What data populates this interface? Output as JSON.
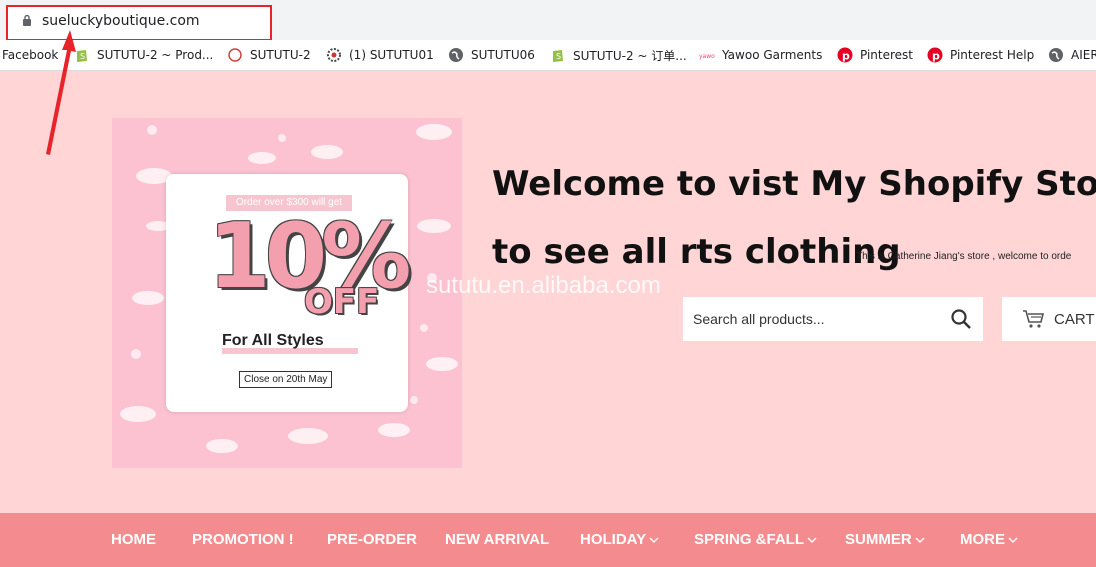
{
  "browser": {
    "url": "sueluckyboutique.com",
    "bookmarks": [
      {
        "label": "Facebook",
        "icon": "none"
      },
      {
        "label": "SUTUTU-2 ~ Prod...",
        "icon": "shopify-icon"
      },
      {
        "label": "SUTUTU-2",
        "icon": "sututu-icon"
      },
      {
        "label": "(1) SUTUTU01",
        "icon": "gear-badge-icon"
      },
      {
        "label": "SUTUTU06",
        "icon": "globe-icon"
      },
      {
        "label": "SUTUTU-2 ~ 订单...",
        "icon": "shopify-icon"
      },
      {
        "label": "Yawoo Garments",
        "icon": "yawoo-icon"
      },
      {
        "label": "Pinterest",
        "icon": "pinterest-icon"
      },
      {
        "label": "Pinterest Help",
        "icon": "pinterest-icon"
      },
      {
        "label": "AIER",
        "icon": "globe-icon"
      }
    ]
  },
  "promo": {
    "order_tag": "Order over $300 will get",
    "discount": "10%",
    "off": "OFF",
    "styles": "For All Styles",
    "close_date": "Close on 20th May"
  },
  "header": {
    "title_line1": "Welcome to vist My Shopify Store",
    "title_line2": "to see all rts clothing",
    "note": "This is Catherine Jiang's store , welcome to orde"
  },
  "watermark": "sututu.en.alibaba.com",
  "search": {
    "placeholder": "Search all products..."
  },
  "cart": {
    "label": "CART"
  },
  "nav": [
    {
      "label": "HOME",
      "dropdown": false
    },
    {
      "label": "PROMOTION !",
      "dropdown": false
    },
    {
      "label": "PRE-ORDER",
      "dropdown": false
    },
    {
      "label": "NEW ARRIVAL",
      "dropdown": false
    },
    {
      "label": "HOLIDAY",
      "dropdown": true
    },
    {
      "label": "SPRING &FALL",
      "dropdown": true
    },
    {
      "label": "SUMMER",
      "dropdown": true
    },
    {
      "label": "MORE",
      "dropdown": true
    }
  ],
  "colors": {
    "page_bg": "#ffd5d6",
    "nav_bg": "#f48b8e",
    "highlight_red": "#e8242a",
    "promo_pink": "#fcc2d1"
  }
}
